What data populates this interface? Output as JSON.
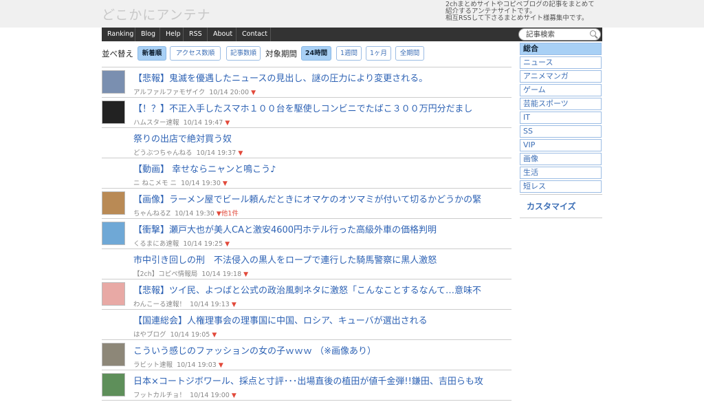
{
  "site": {
    "logo": "どこかにアンテナ",
    "tagline": [
      "2chまとめサイトやコピペブログの記事をまとめて",
      "紹介するアンテナサイトです。",
      "相互RSSして下さるまとめサイト様募集中です。"
    ]
  },
  "nav": [
    "Ranking",
    "Blog",
    "Help",
    "RSS",
    "About",
    "Contact"
  ],
  "search": {
    "placeholder": "記事検索"
  },
  "sort": {
    "label": "並べ替え",
    "options": [
      "新着順",
      "アクセス数順",
      "記事数順"
    ],
    "period_label": "対象期間",
    "periods": [
      "24時間",
      "1週間",
      "1ヶ月",
      "全期間"
    ]
  },
  "articles": [
    {
      "title": "【悲報】鬼滅を優遇したニュースの見出し、謎の圧力により変更される。",
      "source": "アルファルファモザイク",
      "time": "10/14 20:00",
      "others": ""
    },
    {
      "title": "【！？】不正入手したスマホ１００台を駆使しコンビニでたばこ３００万円分だまし",
      "source": "ハムスター速報",
      "time": "10/14 19:47",
      "others": ""
    },
    {
      "title": "祭りの出店で絶対買う奴",
      "source": "どうぶつちゃんねる",
      "time": "10/14 19:37",
      "others": ""
    },
    {
      "title": "【動画】 幸せならニャンと鳴こう♪",
      "source": "ニ ねこメモ ニ",
      "time": "10/14 19:30",
      "others": ""
    },
    {
      "title": "【画像】ラーメン屋でビール頼んだときにオマケのオツマミが付いて切るかどうかの緊",
      "source": "ちゃんねるZ",
      "time": "10/14 19:30",
      "others": "他1件"
    },
    {
      "title": "【衝撃】瀬戸大也が美人CAと激安4600円ホテル行った高級外車の価格判明",
      "source": "くるまにあ速報",
      "time": "10/14 19:25",
      "others": ""
    },
    {
      "title": "市中引き回しの刑　不法侵入の黒人をロープで連行した騎馬警察に黒人激怒",
      "source": "【2ch】コピペ情報局",
      "time": "10/14 19:18",
      "others": ""
    },
    {
      "title": "【悲報】ツイ民、よつばと公式の政治風刺ネタに激怒「こんなことするなんて…意味不",
      "source": "わんこーる速報！",
      "time": "10/14 19:13",
      "others": ""
    },
    {
      "title": "【国連総会】人権理事会の理事国に中国、ロシア、キューバが選出される",
      "source": "はやブログ",
      "time": "10/14 19:05",
      "others": ""
    },
    {
      "title": "こういう感じのファッションの女の子ｗｗｗ （※画像あり）",
      "source": "ラビット速報",
      "time": "10/14 19:03",
      "others": ""
    },
    {
      "title": "日本×コートジボワール、採点と寸評･･･出場直後の植田が値千金弾!!鎌田、吉田らも攻",
      "source": "フットカルチョ！",
      "time": "10/14 19:00",
      "others": ""
    }
  ],
  "sidebar": {
    "categories": [
      "総合",
      "ニュース",
      "アニメマンガ",
      "ゲーム",
      "芸能スポーツ",
      "IT",
      "SS",
      "VIP",
      "画像",
      "生活",
      "短レス"
    ],
    "customize": "カスタマイズ"
  },
  "colors": {
    "accent": "#a8d0f5",
    "link": "#2d62b4",
    "nav_bg": "#333333",
    "marker": "#e24a3b"
  }
}
